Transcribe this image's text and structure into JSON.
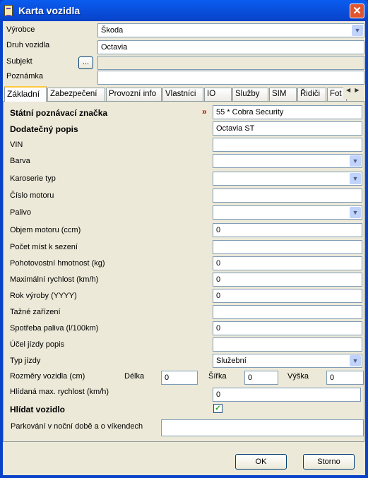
{
  "window": {
    "title": "Karta vozidla",
    "close": "✕"
  },
  "header": {
    "manufacturer": {
      "label": "Výrobce",
      "value": "Škoda"
    },
    "vehicle_type": {
      "label": "Druh vozidla",
      "value": "Octavia"
    },
    "subject": {
      "label": "Subjekt",
      "button": "...",
      "value": ""
    },
    "note": {
      "label": "Poznámka",
      "value": ""
    }
  },
  "tabs": [
    "Základní",
    "Zabezpečení",
    "Provozní info",
    "Vlastníci",
    "IO",
    "Služby",
    "SIM",
    "Řidiči",
    "Fot"
  ],
  "tab_scroll": {
    "left": "◀",
    "right": "▶"
  },
  "fields": [
    {
      "label": "Státní poznávací značka",
      "value": "55 * Cobra Security",
      "bold": true,
      "marker": "»",
      "type": "text"
    },
    {
      "label": "Dodatečný popis",
      "value": "Octavia ST",
      "bold": true,
      "type": "text"
    },
    {
      "label": "VIN",
      "value": "",
      "type": "text"
    },
    {
      "label": "Barva",
      "value": "",
      "type": "select"
    },
    {
      "label": "Karoserie typ",
      "value": "",
      "type": "select"
    },
    {
      "label": "Číslo motoru",
      "value": "",
      "type": "text"
    },
    {
      "label": "Palivo",
      "value": "",
      "type": "select"
    },
    {
      "label": "Objem motoru (ccm)",
      "value": "0",
      "type": "text"
    },
    {
      "label": "Počet míst k sezení",
      "value": "",
      "type": "text"
    },
    {
      "label": "Pohotovostní hmotnost (kg)",
      "value": "0",
      "type": "text"
    },
    {
      "label": "Maximální rychlost (km/h)",
      "value": "0",
      "type": "text"
    },
    {
      "label": "Rok výroby (YYYY)",
      "value": "0",
      "type": "text"
    },
    {
      "label": "Tažné zařízení",
      "value": "",
      "type": "text"
    },
    {
      "label": "Spotřeba paliva (l/100km)",
      "value": "0",
      "type": "text"
    },
    {
      "label": "Účel jízdy popis",
      "value": "",
      "type": "text"
    },
    {
      "label": "Typ jízdy",
      "value": "Služební",
      "type": "select"
    }
  ],
  "dimensions": {
    "label": "Rozměry vozidla (cm)",
    "length_label": "Délka",
    "length": "0",
    "width_label": "Šířka",
    "width": "0",
    "height_label": "Výška",
    "height": "0"
  },
  "watched_speed": {
    "label": "Hlídaná max. rychlost (km/h)",
    "value": "0"
  },
  "watch_vehicle": {
    "label": "Hlídat vozidlo",
    "checked": true,
    "check": "✓"
  },
  "parking": {
    "label": "Parkování v noční době a o víkendech",
    "value": ""
  },
  "buttons": {
    "ok": "OK",
    "cancel": "Storno"
  }
}
